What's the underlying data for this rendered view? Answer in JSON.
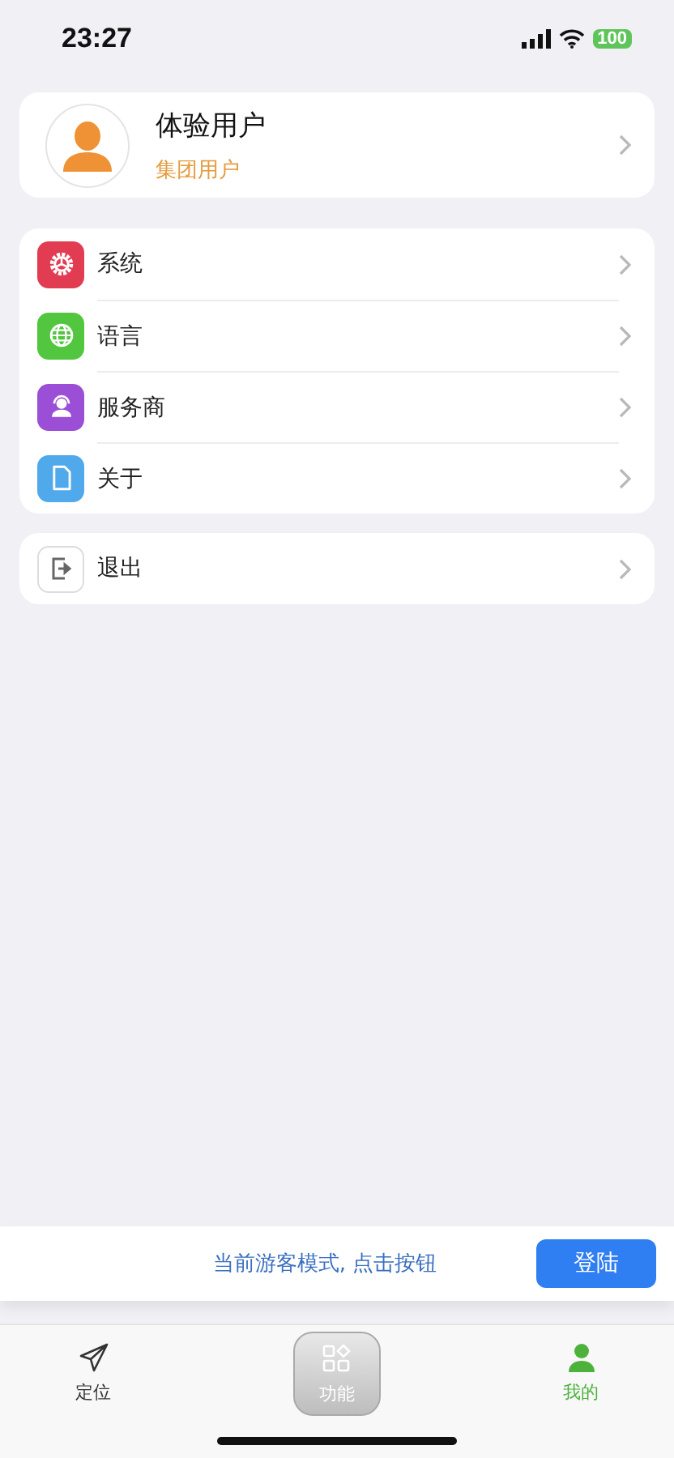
{
  "status_bar": {
    "time": "23:27",
    "battery": "100"
  },
  "profile": {
    "name": "体验用户",
    "role": "集团用户"
  },
  "menu": [
    {
      "kind": "gear",
      "label": "系统",
      "color": "#e23c53"
    },
    {
      "kind": "globe",
      "label": "语言",
      "color": "#52c63f"
    },
    {
      "kind": "headset",
      "label": "服务商",
      "color": "#9b4fd6"
    },
    {
      "kind": "document",
      "label": "关于",
      "color": "#4fa9ea"
    }
  ],
  "logout": {
    "label": "退出"
  },
  "guest_banner": {
    "message": "当前游客模式, 点击按钮",
    "button": "登陆"
  },
  "tabs": [
    {
      "kind": "send",
      "label": "定位",
      "selected": false
    },
    {
      "kind": "grid",
      "label": "功能",
      "selected": false
    },
    {
      "kind": "person",
      "label": "我的",
      "selected": true
    }
  ]
}
